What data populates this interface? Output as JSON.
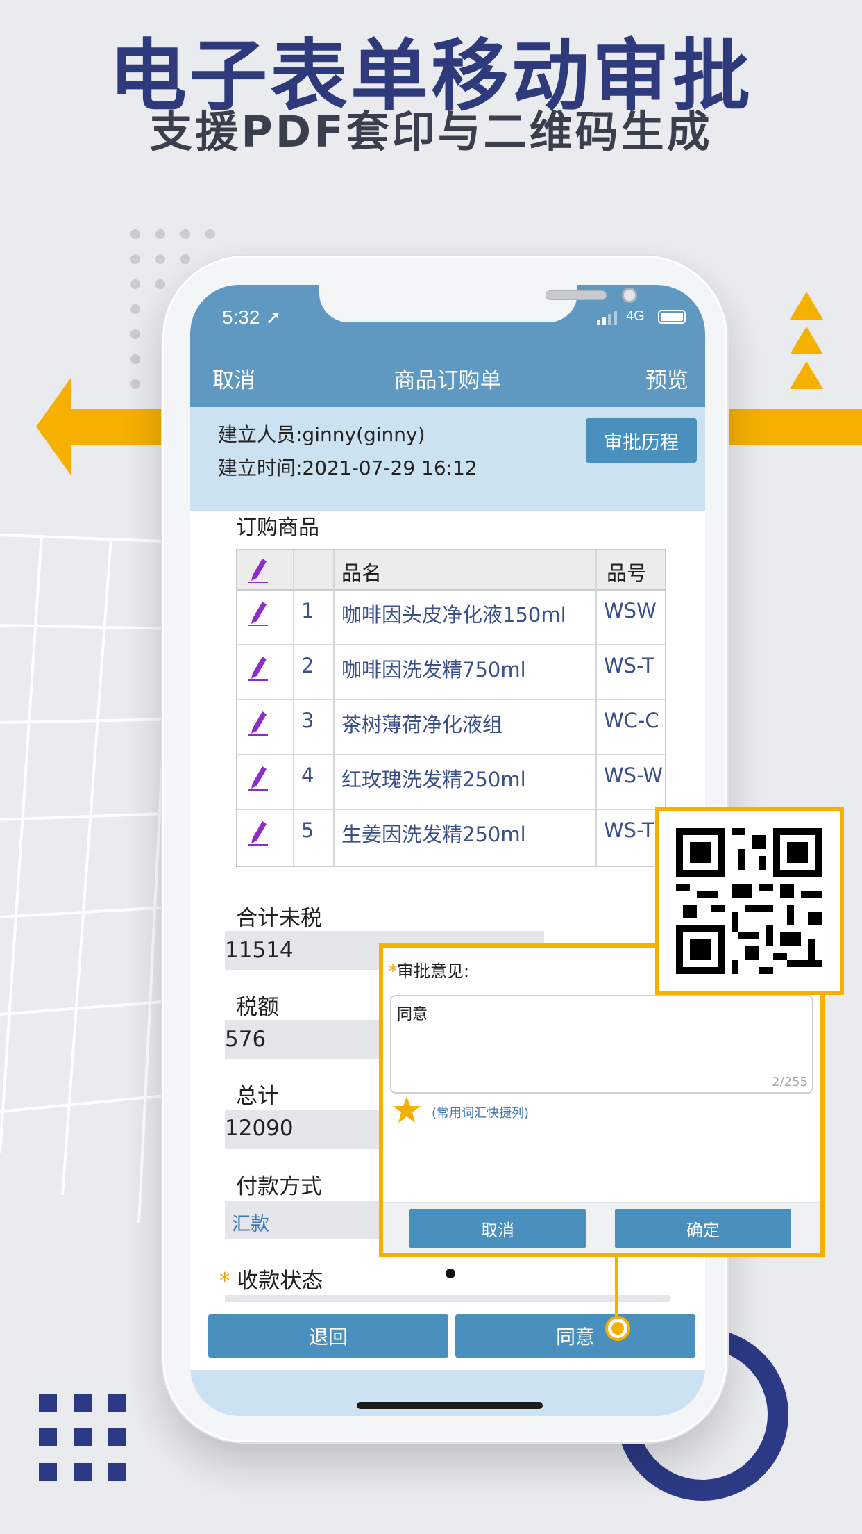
{
  "banner": {
    "title": "电子表单移动审批",
    "subtitle": "支援PDF套印与二维码生成"
  },
  "status_bar": {
    "time": "5:32",
    "network": "4G"
  },
  "nav": {
    "left": "取消",
    "title": "商品订购单",
    "right": "预览"
  },
  "info": {
    "creator": "建立人员:ginny(ginny)",
    "created_at": "建立时间:2021-07-29 16:12",
    "history_button": "审批历程"
  },
  "order_section": {
    "title": "订购商品",
    "columns": [
      "品名",
      "品号"
    ],
    "rows": [
      {
        "no": "1",
        "name": "咖啡因头皮净化液150ml",
        "code": "WSW"
      },
      {
        "no": "2",
        "name": "咖啡因洗发精750ml",
        "code": "WS-T"
      },
      {
        "no": "3",
        "name": "茶树薄荷净化液组",
        "code": "WC-C"
      },
      {
        "no": "4",
        "name": "红玫瑰洗发精250ml",
        "code": "WS-W"
      },
      {
        "no": "5",
        "name": "生姜因洗发精250ml",
        "code": "WS-T"
      }
    ]
  },
  "fields": {
    "subtotal_label": "合计未税",
    "subtotal_value": "11514",
    "tax_label": "税额",
    "tax_value": "576",
    "total_label": "总计",
    "total_value": "12090",
    "payment_label": "付款方式",
    "payment_value": "汇款",
    "receipt_label": "收款状态",
    "required_mark": "*"
  },
  "actions": {
    "reject": "退回",
    "approve": "同意"
  },
  "popup": {
    "required_mark": "*",
    "label": "审批意见:",
    "text": "同意",
    "counter": "2/255",
    "shortcut": "(常用词汇快捷列)",
    "cancel": "取消",
    "confirm": "确定"
  },
  "colors": {
    "brand_navy": "#2e3a7c",
    "accent_yellow": "#f5b000",
    "header_blue": "#5f99c1",
    "button_blue": "#4a90bf"
  }
}
